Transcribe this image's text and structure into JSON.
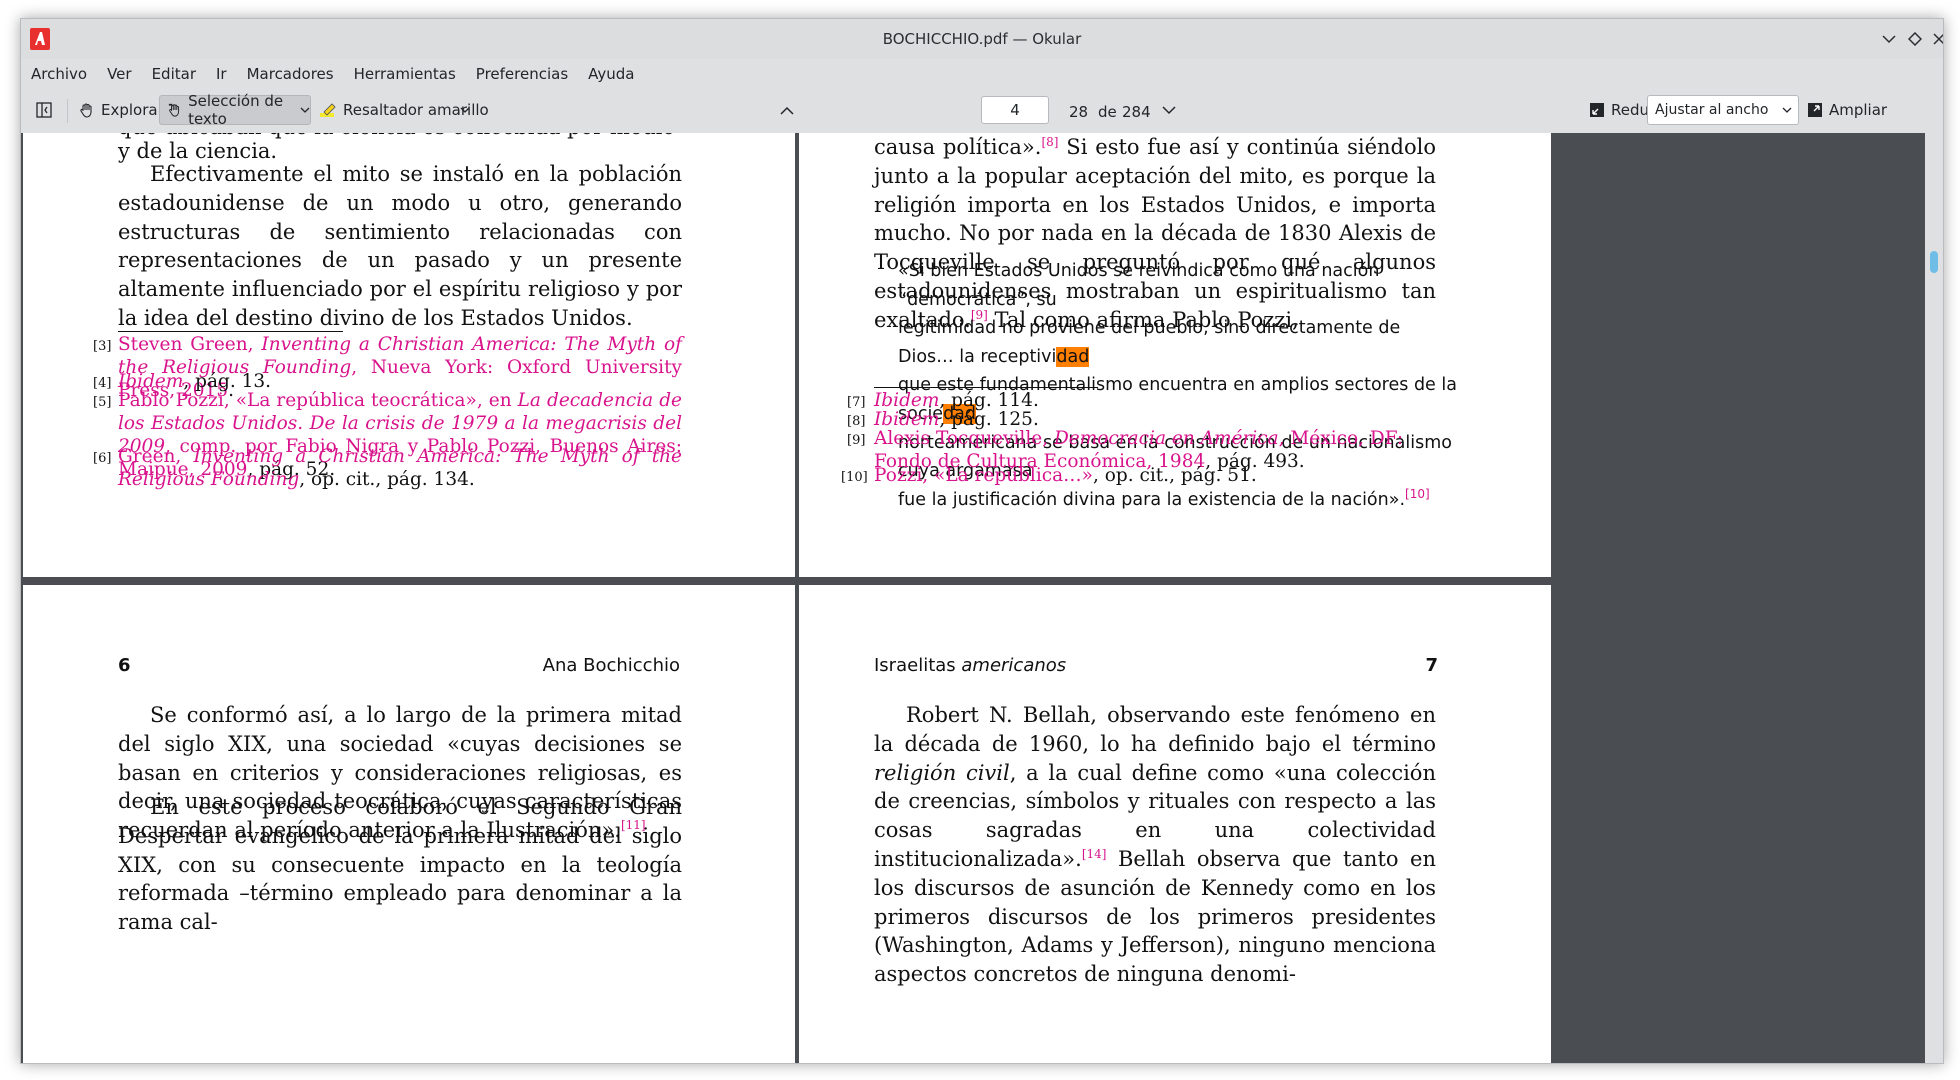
{
  "window": {
    "title": "BOCHICCHIO.pdf — Okular"
  },
  "menu": [
    "Archivo",
    "Ver",
    "Editar",
    "Ir",
    "Marcadores",
    "Herramientas",
    "Preferencias",
    "Ayuda"
  ],
  "toolbar": {
    "browse_label": "Explorar",
    "text_selection_label": "Selección de texto",
    "highlighter_label": "Resaltador amarillo",
    "page_current": "4",
    "page_number_label": "28",
    "of_label": "de",
    "page_total": "284",
    "zoom_out_label": "Reducir",
    "zoom_mode": "Ajustar al ancho",
    "zoom_in_label": "Ampliar"
  },
  "page_left_top": {
    "para_cut": "que ubicaban que la ciencia es concebida por medio de la razón",
    "para_end": "y de la ciencia.",
    "para": "Efectivamente el mito se instaló en la población estadounidense de un modo u otro, generando estructuras de sentimiento relacionadas con representaciones de un pasado y un presente altamente influenciado por el espíritu religioso y por la idea del destino divino de los Estados Unidos.",
    "footnotes": [
      {
        "num": "[3]",
        "link": "Steven Green, ",
        "italic": "Inventing a Christian America: The Myth of the Religious Founding",
        "link2": ", Nueva York: Oxford University Press, 2015",
        "rest": "."
      },
      {
        "num": "[4]",
        "italic": "Ibidem",
        "rest": ", pág. 13."
      },
      {
        "num": "[5]",
        "link": "Pablo Pozzi, «La república teocrática», en ",
        "italic": "La decadencia de los Estados Unidos. De la crisis de 1979 a la megacrisis del 2009",
        "link2": ", comp. por Fabio Nigra y Pablo Pozzi, Buenos Aires: Maipue, 2009",
        "rest": ", pág. 52."
      },
      {
        "num": "[6]",
        "link": "Green, ",
        "italic": "Inventing a Christian America: The Myth of the Religious Founding",
        "rest": ", op. cit., pág. 134."
      }
    ]
  },
  "page_right_top": {
    "para_a": "causa política».",
    "sup_8": "[8]",
    "para_b": " Si esto fue así y continúa siéndolo junto a la popular aceptación del mito, es porque la religión importa en los Estados Unidos, e importa mucho. No por nada en la década de 1830 Alexis de Tocqueville se preguntó por qué algunos estadounidenses mostraban un espiritualismo tan exaltado.",
    "sup_9": "[9]",
    "para_c": " Tal como afirma Pablo Pozzi,",
    "quote_l1": "«Si bien Estados Unidos se reivindica como una nación “democrática”, su",
    "quote_l2a": "legitimidad no proviene del pueblo, sino directamente de Dios… la receptivi",
    "quote_l2b": "dad",
    "quote_l3a": "que este fundamentalismo encuentra en amplios sectores de la socie",
    "quote_l3b": "dad",
    "quote_l4": "norteamericana se basa en la construcción de un nacionalismo cuya argamasa",
    "quote_l5": "fue la justificación divina para la existencia de la nación».",
    "sup_10": "[10]",
    "footnotes": [
      {
        "num": "[7]",
        "italic": "Ibidem",
        "rest": ", pág. 114."
      },
      {
        "num": "[8]",
        "italic": "Ibidem",
        "rest": ", pág. 125."
      },
      {
        "num": "[9]",
        "link": "Alexis Tocqueville, ",
        "italic": "Democracia en América",
        "link2": ", México, DF: Fondo de Cultura Económica, 1984",
        "rest": ", pág. 493."
      },
      {
        "num": "[10]",
        "link": "Pozzi, «La república…»",
        "rest": ", op. cit., pág. 51."
      }
    ]
  },
  "page_6": {
    "page_number": "6",
    "running_head": "Ana Bochicchio",
    "para1a": "Se conformó así, a lo largo de la primera mitad del siglo XIX, una sociedad «cuyas decisiones se basan en criterios y consideraciones religiosas, es decir, una sociedad teocrática, cuyas características recuerdan al período anterior a la Ilustración».",
    "sup_11": "[11]",
    "para2": "En este proceso colaboró el Segundo Gran Despertar evangélico de la primera mitad del siglo XIX, con su consecuente impacto en la teología reformada –término empleado para denominar a la rama cal-"
  },
  "page_7": {
    "page_number": "7",
    "running_head_a": "Israelitas ",
    "running_head_b": "americanos",
    "para_a": "Robert N. Bellah, observando este fenómeno en la década de 1960, lo ha definido bajo el término ",
    "para_italic": "religión civil",
    "para_b": ", a la cual define como «una colección de creencias, símbolos y rituales con respecto a las cosas sagradas en una colectividad institucionalizada».",
    "sup_14": "[14]",
    "para_c": " Bellah observa que tanto en los discursos de asunción de Kennedy como en los primeros discursos de los primeros presidentes (Washington, Adams y Jefferson), ninguno menciona aspectos concretos de ninguna denomi-"
  },
  "colors": {
    "link": "#d8138c",
    "highlight": "#ff7f00",
    "canvas": "#4a4d52",
    "accent": "#3daee9"
  }
}
